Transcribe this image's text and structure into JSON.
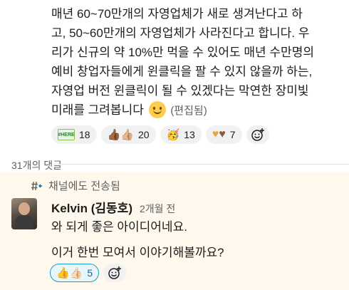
{
  "message": {
    "text": "매년 60~70만개의 자영업체가 새로 생겨난다고 하\n고, 50~60만개의 자영업체가 사라진다고 합니다. 우\n리가 신규의 약 10%만 먹을 수 있어도 매년 수만명의\n예비 창업자들에게 윈클릭을 팔 수 있지 않을까 하는,\n자영업 버전 윈클릭이 될 수 있겠다는 막연한 장미빛\n미래를 그려봅니다",
    "edited_label": "(편집됨)",
    "reactions": [
      {
        "icon": "hashtag-sticker-icon",
        "count": "18"
      },
      {
        "icon": "thumbs-up-skin-tones-icon",
        "count": "20"
      },
      {
        "icon": "party-face-icon",
        "count": "13"
      },
      {
        "icon": "heart-hands-icon",
        "count": "7"
      }
    ]
  },
  "thread": {
    "reply_count_label": "31개의 댓글"
  },
  "reply": {
    "sent_to_channel": "채널에도 전송됨",
    "author": "Kelvin (김동호)",
    "timestamp": "2개월 전",
    "lines": [
      "와 되게 좋은 아이디어네요.",
      "이거 한번 모여서 이야기해볼까요?"
    ],
    "reactions": [
      {
        "icon": "thumbs-up-icon",
        "count": "5"
      }
    ]
  }
}
